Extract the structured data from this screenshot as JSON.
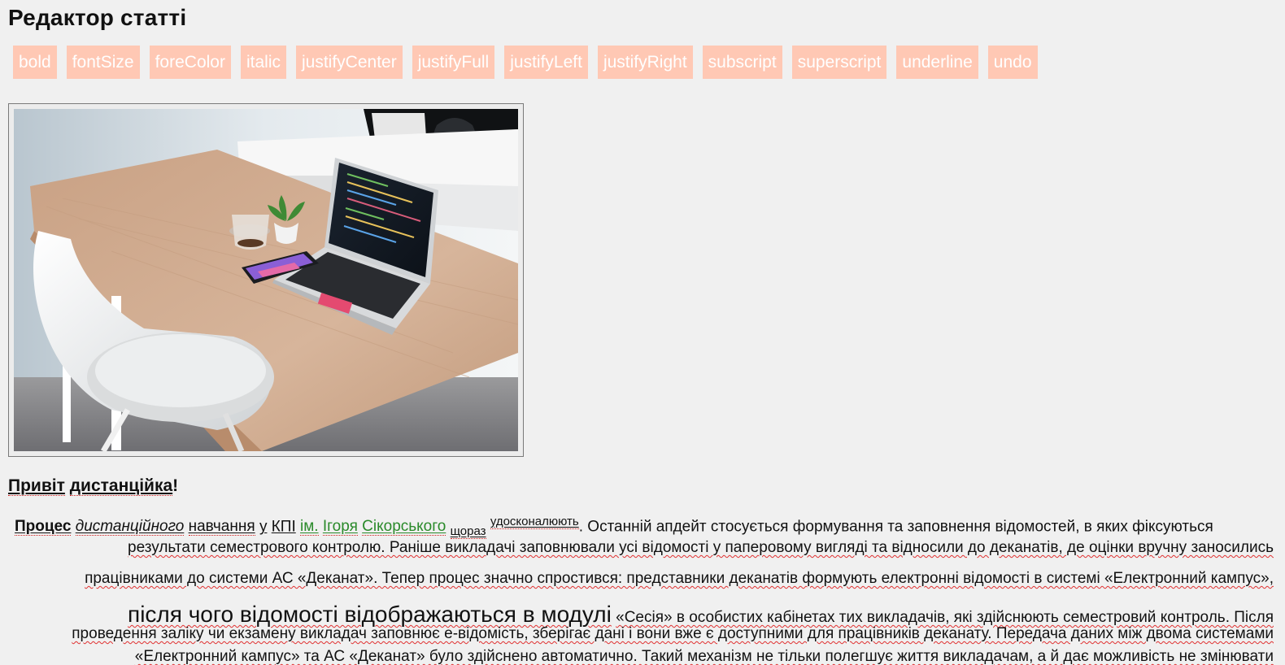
{
  "page": {
    "title": "Редактор статті"
  },
  "toolbar": {
    "buttons": [
      "bold",
      "fontSize",
      "foreColor",
      "italic",
      "justifyCenter",
      "justifyFull",
      "justifyLeft",
      "justifyRight",
      "subscript",
      "superscript",
      "underline",
      "undo"
    ]
  },
  "image": {
    "alt": "Робоче місце з ноутбуком"
  },
  "article": {
    "heading_a": "Привіт",
    "heading_b": "дистанційка",
    "heading_c": "!",
    "l1": {
      "a": "Процес",
      "b": "дистанційного",
      "c": "навчання",
      "d": "у",
      "e": "КПІ",
      "f": "ім.",
      "g": "Ігоря",
      "h": "Сікорського",
      "i": "щораз",
      "j": "удосконалюють",
      "k": ". Останній апдейт стосується формування та заповнення відомостей, в яких фіксуються"
    },
    "l2": "результати семестрового контролю. Раніше викладачі заповнювали усі відомості у паперовому вигляді та відносили до деканатів, де оцінки вручну заносились",
    "l3": "працівниками до системи АС «Деканат». Тепер процес значно спростився: представники деканатів формують електронні відомості в системі «Електронний кампус»,",
    "l4": {
      "big": "після чого відомості відображаються в модулі",
      "rest": "«Сесія» в особистих кабінетах тих викладачів, які здійснюють семестровий контроль. Після"
    },
    "l5": "проведення заліку чи екзамену викладач заповнює е-відомість, зберігає дані і вони вже є доступними для працівників деканату. Передача даних між двома системами",
    "l6": "«Електронний кампус» та АС «Деканат» було здійснено автоматично. Такий механізм не тільки полегшує життя викладачам, а й дає можливість не змінювати"
  }
}
